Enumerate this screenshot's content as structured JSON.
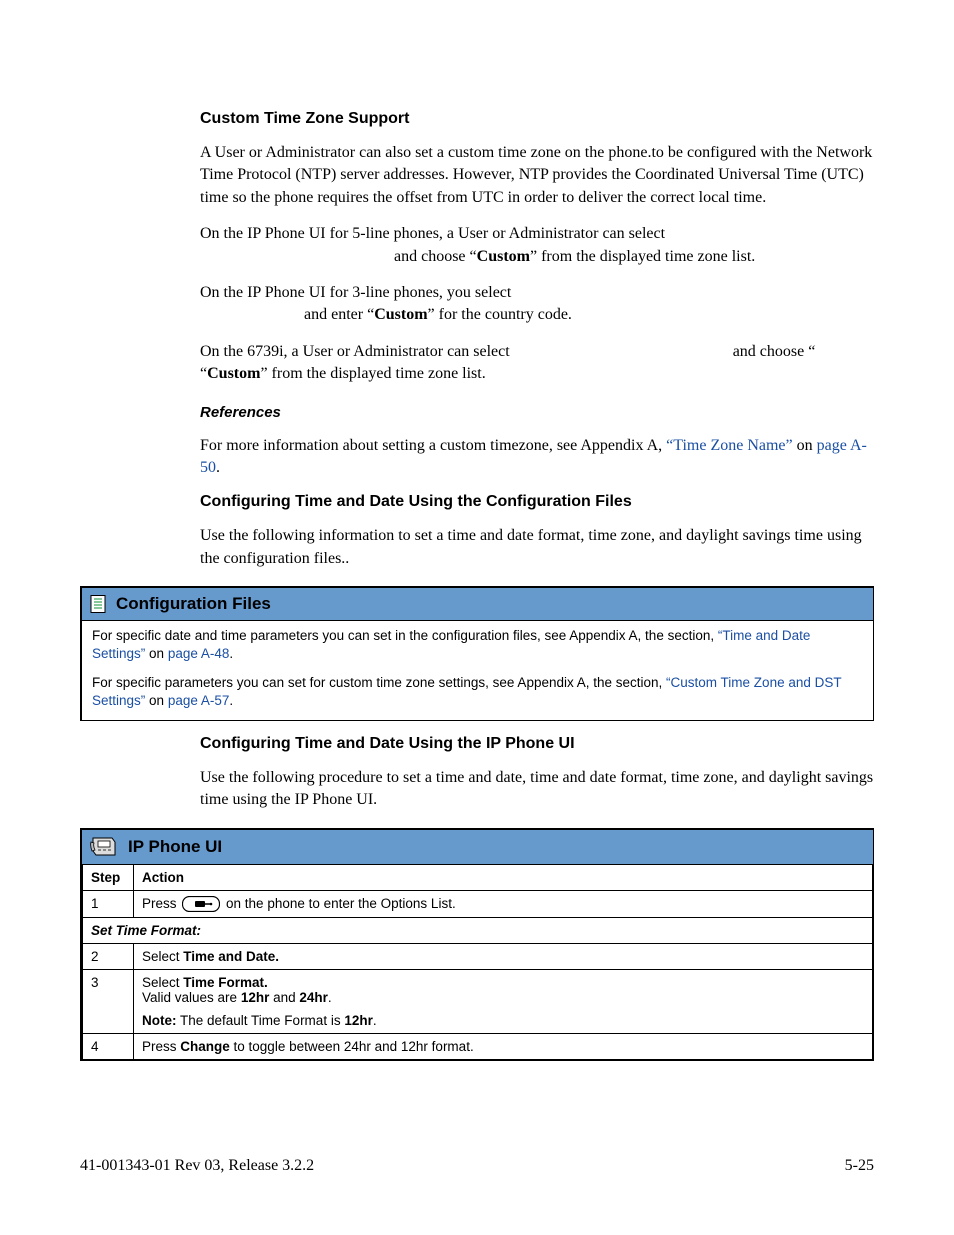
{
  "sections": {
    "s1_title": "Custom Time Zone Support",
    "s1_p1": "A User or Administrator can also set a custom time zone on the phone.to be configured with the Network Time Protocol (NTP) server addresses. However, NTP provides the Coordinated Universal Time (UTC) time so the phone requires the offset from UTC in order to deliver the correct local time.",
    "s1_p2_a": "On the IP Phone UI for 5-line phones, a User or Administrator can select",
    "s1_p2_b": " and choose “",
    "s1_p2_custom": "Custom",
    "s1_p2_c": "” from the displayed time zone list.",
    "s1_p3_a": "On the IP Phone UI for 3-line phones, you select",
    "s1_p3_b": " and enter “",
    "s1_p3_custom": "Custom",
    "s1_p3_c": "” for the country code.",
    "s1_p4_a": "On the 6739i, a User or Administrator can select ",
    "s1_p4_b": " and choose “",
    "s1_p4_custom": "Custom",
    "s1_p4_c": "” from the displayed time zone list.",
    "ref_title": "References",
    "ref_p_a": "For more information about setting a custom timezone, see Appendix A, ",
    "ref_link1": "“Time Zone Name”",
    "ref_p_b": " on ",
    "ref_link2": "page A-50",
    "ref_p_c": ".",
    "s2_title": "Configuring Time and Date Using the Configuration Files",
    "s2_p1": "Use the following information to set a time and date format, time zone, and daylight savings time using the configuration files..",
    "s3_title": "Configuring Time and Date Using the IP Phone UI",
    "s3_p1": "Use the following procedure to set a time and date, time and date format, time zone, and daylight savings time using the IP Phone UI."
  },
  "config_box": {
    "title": "Configuration Files",
    "p1_a": "For specific date and time parameters you can set in the configuration files, see Appendix A, the section, ",
    "p1_link": "“Time and Date Settings”",
    "p1_b": " on ",
    "p1_link2": "page A-48",
    "p1_c": ".",
    "p2_a": "For specific parameters you can set for custom time zone settings, see Appendix A, the section, ",
    "p2_link": "“Custom Time Zone and DST Settings”",
    "p2_b": " on ",
    "p2_link2": "page A-57",
    "p2_c": "."
  },
  "ipphone_box": {
    "title": "IP Phone UI",
    "headers": {
      "step": "Step",
      "action": "Action"
    },
    "section_row": "Set Time Format:",
    "rows": {
      "r1_step": "1",
      "r1_a": "Press ",
      "r1_b": " on the phone to enter the Options List.",
      "r2_step": "2",
      "r2_a": "Select ",
      "r2_bold": "Time and Date.",
      "r3_step": "3",
      "r3_a": "Select ",
      "r3_bold1": "Time Format.",
      "r3_b": "Valid values are ",
      "r3_bold2": "12hr",
      "r3_c": " and ",
      "r3_bold3": "24hr",
      "r3_d": ".",
      "r3_note_label": "Note:",
      "r3_note_a": " The default Time Format is ",
      "r3_note_bold": "12hr",
      "r3_note_b": ".",
      "r4_step": "4",
      "r4_a": "Press ",
      "r4_bold": "Change",
      "r4_b": " to toggle between 24hr and 12hr format."
    }
  },
  "footer": {
    "left": "41-001343-01 Rev 03, Release 3.2.2",
    "right": "5-25"
  }
}
